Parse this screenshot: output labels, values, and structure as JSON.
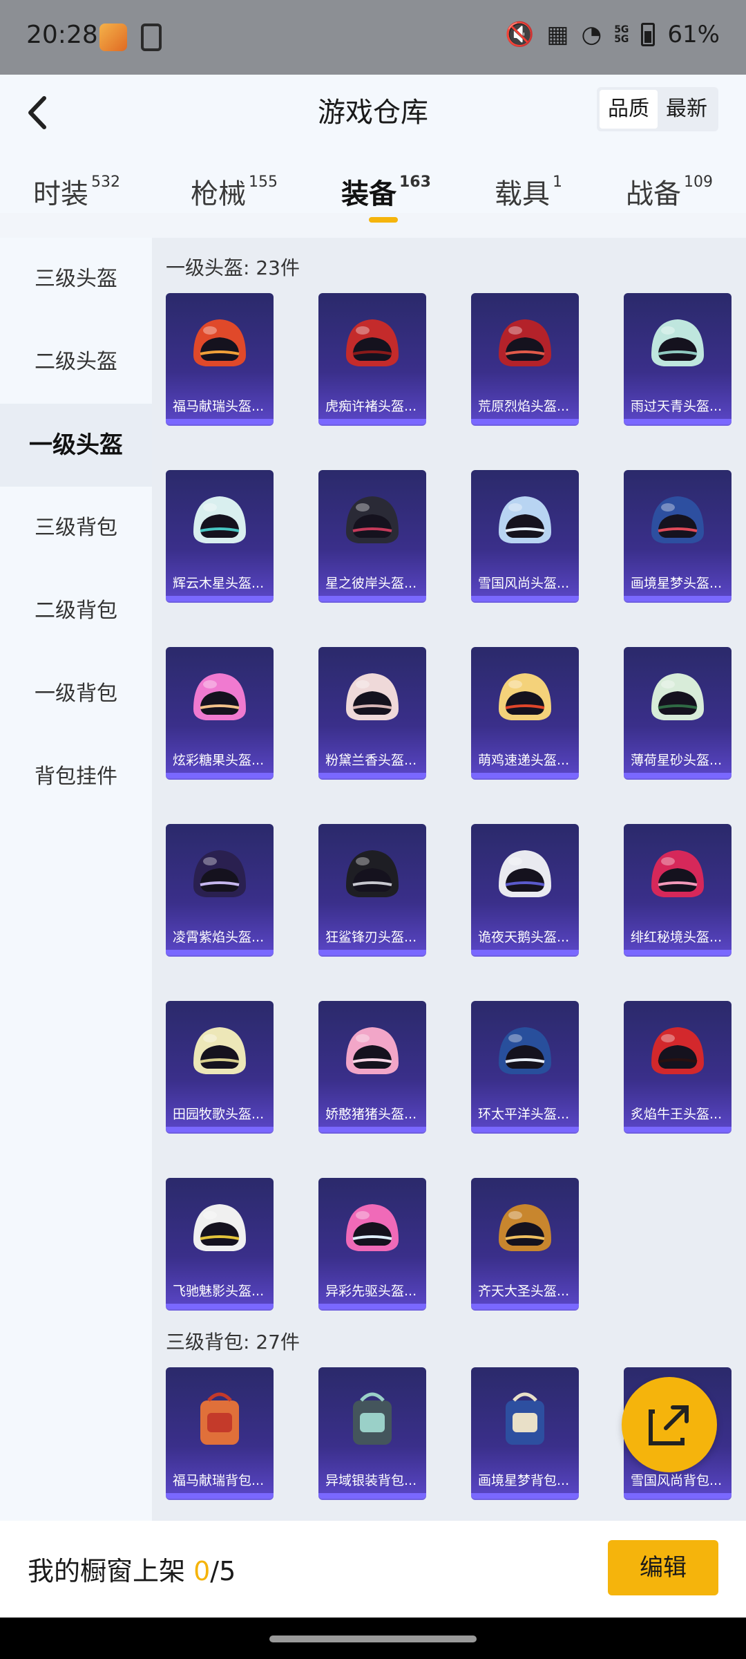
{
  "status_bar": {
    "time": "20:28",
    "battery": "61%",
    "net1": "5G",
    "net2": "5G"
  },
  "header": {
    "title": "游戏仓库",
    "sort_options": [
      "品质",
      "最新"
    ]
  },
  "tabs": [
    {
      "label": "时装",
      "count": "532"
    },
    {
      "label": "枪械",
      "count": "155"
    },
    {
      "label": "装备",
      "count": "163"
    },
    {
      "label": "载具",
      "count": "1"
    },
    {
      "label": "战备",
      "count": "109"
    }
  ],
  "sidebar": [
    "三级头盔",
    "二级头盔",
    "一级头盔",
    "三级背包",
    "二级背包",
    "一级背包",
    "背包挂件"
  ],
  "section1": {
    "title": "一级头盔: 23件",
    "items": [
      {
        "name": "福马献瑞头盔...",
        "color": "#e0492a",
        "accent": "#f0a13a"
      },
      {
        "name": "虎痴许褚头盔...",
        "color": "#c42b2b",
        "accent": "#8a1a1a"
      },
      {
        "name": "荒原烈焰头盔...",
        "color": "#b4222a",
        "accent": "#e25a4a"
      },
      {
        "name": "雨过天青头盔...",
        "color": "#bfe6de",
        "accent": "#8fc9c0"
      },
      {
        "name": "辉云木星头盔...",
        "color": "#d9efef",
        "accent": "#49c7c3"
      },
      {
        "name": "星之彼岸头盔...",
        "color": "#2a2a36",
        "accent": "#c43a5a"
      },
      {
        "name": "雪国风尚头盔...",
        "color": "#b8d4f2",
        "accent": "#e6f0fb"
      },
      {
        "name": "画境星梦头盔...",
        "color": "#2d4fa0",
        "accent": "#e04a5a"
      },
      {
        "name": "炫彩糖果头盔...",
        "color": "#f07ad0",
        "accent": "#f3c28a"
      },
      {
        "name": "粉黛兰香头盔...",
        "color": "#efd9d9",
        "accent": "#d8b6b6"
      },
      {
        "name": "萌鸡速递头盔...",
        "color": "#f4d27a",
        "accent": "#e0462a"
      },
      {
        "name": "薄荷星砂头盔...",
        "color": "#d8ecd9",
        "accent": "#2f6a44"
      },
      {
        "name": "凌霄紫焰头盔...",
        "color": "#2a2050",
        "accent": "#c8b8f0"
      },
      {
        "name": "狂鲨锋刃头盔...",
        "color": "#1e1e24",
        "accent": "#c8c8d0"
      },
      {
        "name": "诡夜天鹅头盔...",
        "color": "#e9eaf0",
        "accent": "#5a5acc"
      },
      {
        "name": "绯红秘境头盔...",
        "color": "#d6285a",
        "accent": "#f39abb"
      },
      {
        "name": "田园牧歌头盔...",
        "color": "#ede7b8",
        "accent": "#d8cf8e"
      },
      {
        "name": "娇憨猪猪头盔...",
        "color": "#f2a6c8",
        "accent": "#fad6e6"
      },
      {
        "name": "环太平洋头盔...",
        "color": "#284f9c",
        "accent": "#e8eef8"
      },
      {
        "name": "炙焰牛王头盔...",
        "color": "#d3282c",
        "accent": "#2a1010"
      },
      {
        "name": "飞驰魅影头盔...",
        "color": "#f0f0f0",
        "accent": "#e4c43a"
      },
      {
        "name": "异彩先驱头盔...",
        "color": "#f06ab8",
        "accent": "#e0f0ff"
      },
      {
        "name": "齐天大圣头盔...",
        "color": "#c8862e",
        "accent": "#f0c060"
      }
    ]
  },
  "section2": {
    "title": "三级背包: 27件",
    "items": [
      {
        "name": "福马献瑞背包...",
        "color": "#e0703a",
        "accent": "#c43a2a"
      },
      {
        "name": "异域银装背包...",
        "color": "#44555c",
        "accent": "#9ad0c8"
      },
      {
        "name": "画境星梦背包...",
        "color": "#2d4fa0",
        "accent": "#e9e0c8"
      },
      {
        "name": "雪国风尚背包...",
        "color": "#dfe6ee",
        "accent": "#5a5acc"
      }
    ]
  },
  "bottom": {
    "shelf_label": "我的橱窗上架",
    "shelf_count": "0",
    "shelf_total": "/5",
    "edit_label": "编辑"
  }
}
